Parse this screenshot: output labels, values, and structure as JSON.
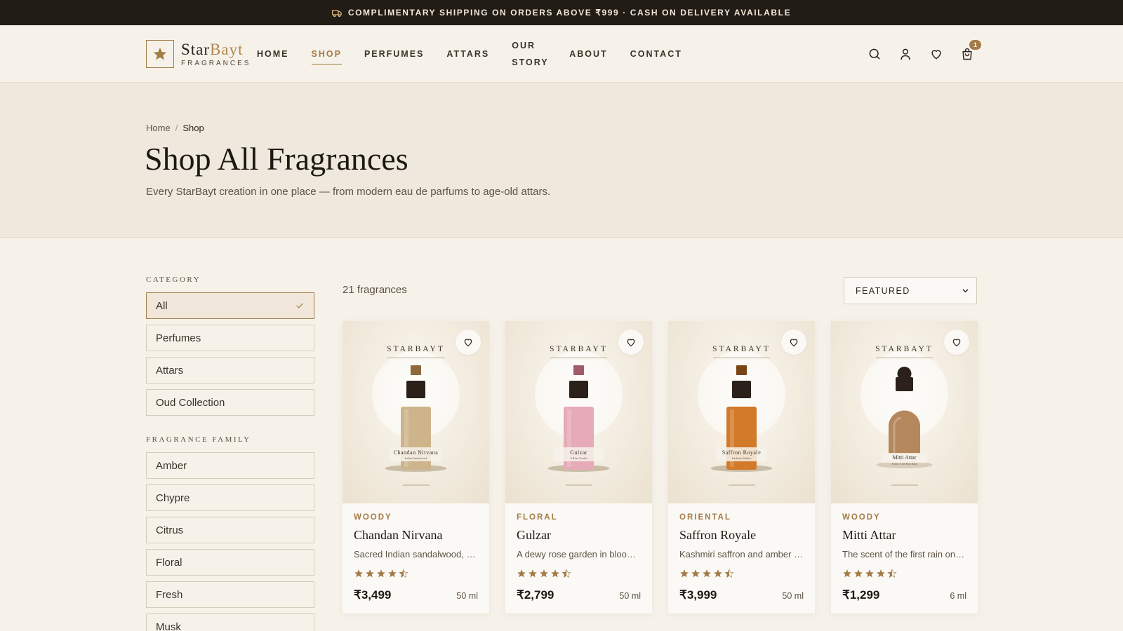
{
  "announcement": {
    "text": "COMPLIMENTARY SHIPPING ON ORDERS ABOVE ₹999 · CASH ON DELIVERY AVAILABLE",
    "icon": "truck-icon"
  },
  "brand": {
    "name_main": "Star",
    "name_accent": "Bayt",
    "sub": "FRAGRANCES",
    "logo_icon": "star-icon"
  },
  "nav": [
    {
      "label": "HOME",
      "active": false
    },
    {
      "label": "SHOP",
      "active": true
    },
    {
      "label": "PERFUMES",
      "active": false
    },
    {
      "label": "ATTARS",
      "active": false
    },
    {
      "label": "OUR STORY",
      "active": false
    },
    {
      "label": "ABOUT",
      "active": false
    },
    {
      "label": "CONTACT",
      "active": false
    }
  ],
  "header_icons": {
    "search": "search-icon",
    "account": "user-icon",
    "wishlist": "heart-icon",
    "cart": "shopping-bag-icon",
    "cart_count": "1"
  },
  "breadcrumb": {
    "home": "Home",
    "separator": "/",
    "current": "Shop"
  },
  "hero": {
    "title": "Shop All Fragrances",
    "subtitle": "Every StarBayt creation in one place — from modern eau de parfums to age-old attars."
  },
  "filters": {
    "category": {
      "title": "CATEGORY",
      "options": [
        "All",
        "Perfumes",
        "Attars",
        "Oud Collection"
      ],
      "selected": "All"
    },
    "family": {
      "title": "FRAGRANCE FAMILY",
      "options": [
        "Amber",
        "Chypre",
        "Citrus",
        "Floral",
        "Fresh",
        "Musk"
      ]
    }
  },
  "results": {
    "count": "21 fragrances",
    "sort_selected": "FEATURED"
  },
  "products": [
    {
      "family": "WOODY",
      "name": "Chandan Nirvana",
      "description": "Sacred Indian sandalwood, creamy and warm",
      "rating": 4.5,
      "price": "₹3,499",
      "volume": "50 ml",
      "brand": "STARBAYT",
      "bottle_label": "Chandan Nirvana",
      "bottle_sub": "Indian Sandalwood",
      "cap_color": "#8c6a3c",
      "liquid_color": "#cdb48a",
      "shape": "rect"
    },
    {
      "family": "FLORAL",
      "name": "Gulzar",
      "description": "A dewy rose garden in bloom at dawn",
      "rating": 4.5,
      "price": "₹2,799",
      "volume": "50 ml",
      "brand": "STARBAYT",
      "bottle_label": "Gulzar",
      "bottle_sub": "A Rose Garden",
      "cap_color": "#a35a6a",
      "liquid_color": "#e6aab8",
      "shape": "rect"
    },
    {
      "family": "ORIENTAL",
      "name": "Saffron Royale",
      "description": "Kashmiri saffron and amber resins",
      "rating": 4.5,
      "price": "₹3,999",
      "volume": "50 ml",
      "brand": "STARBAYT",
      "bottle_label": "Saffron Royale",
      "bottle_sub": "Kashmiri Saffron",
      "cap_color": "#7a4515",
      "liquid_color": "#d2792a",
      "shape": "rect"
    },
    {
      "family": "WOODY",
      "name": "Mitti Attar",
      "description": "The scent of the first rain on dry earth",
      "rating": 4.5,
      "price": "₹1,299",
      "volume": "6 ml",
      "brand": "STARBAYT",
      "bottle_label": "Mitti Attar",
      "bottle_sub": "Scent of the First Rain",
      "cap_color": "#2b211a",
      "liquid_color": "#b5875c",
      "shape": "dome"
    }
  ],
  "colors": {
    "accent": "#a37b47",
    "dark": "#221c16",
    "background": "#f6f2ea",
    "hero_bg": "#efe9dd"
  }
}
